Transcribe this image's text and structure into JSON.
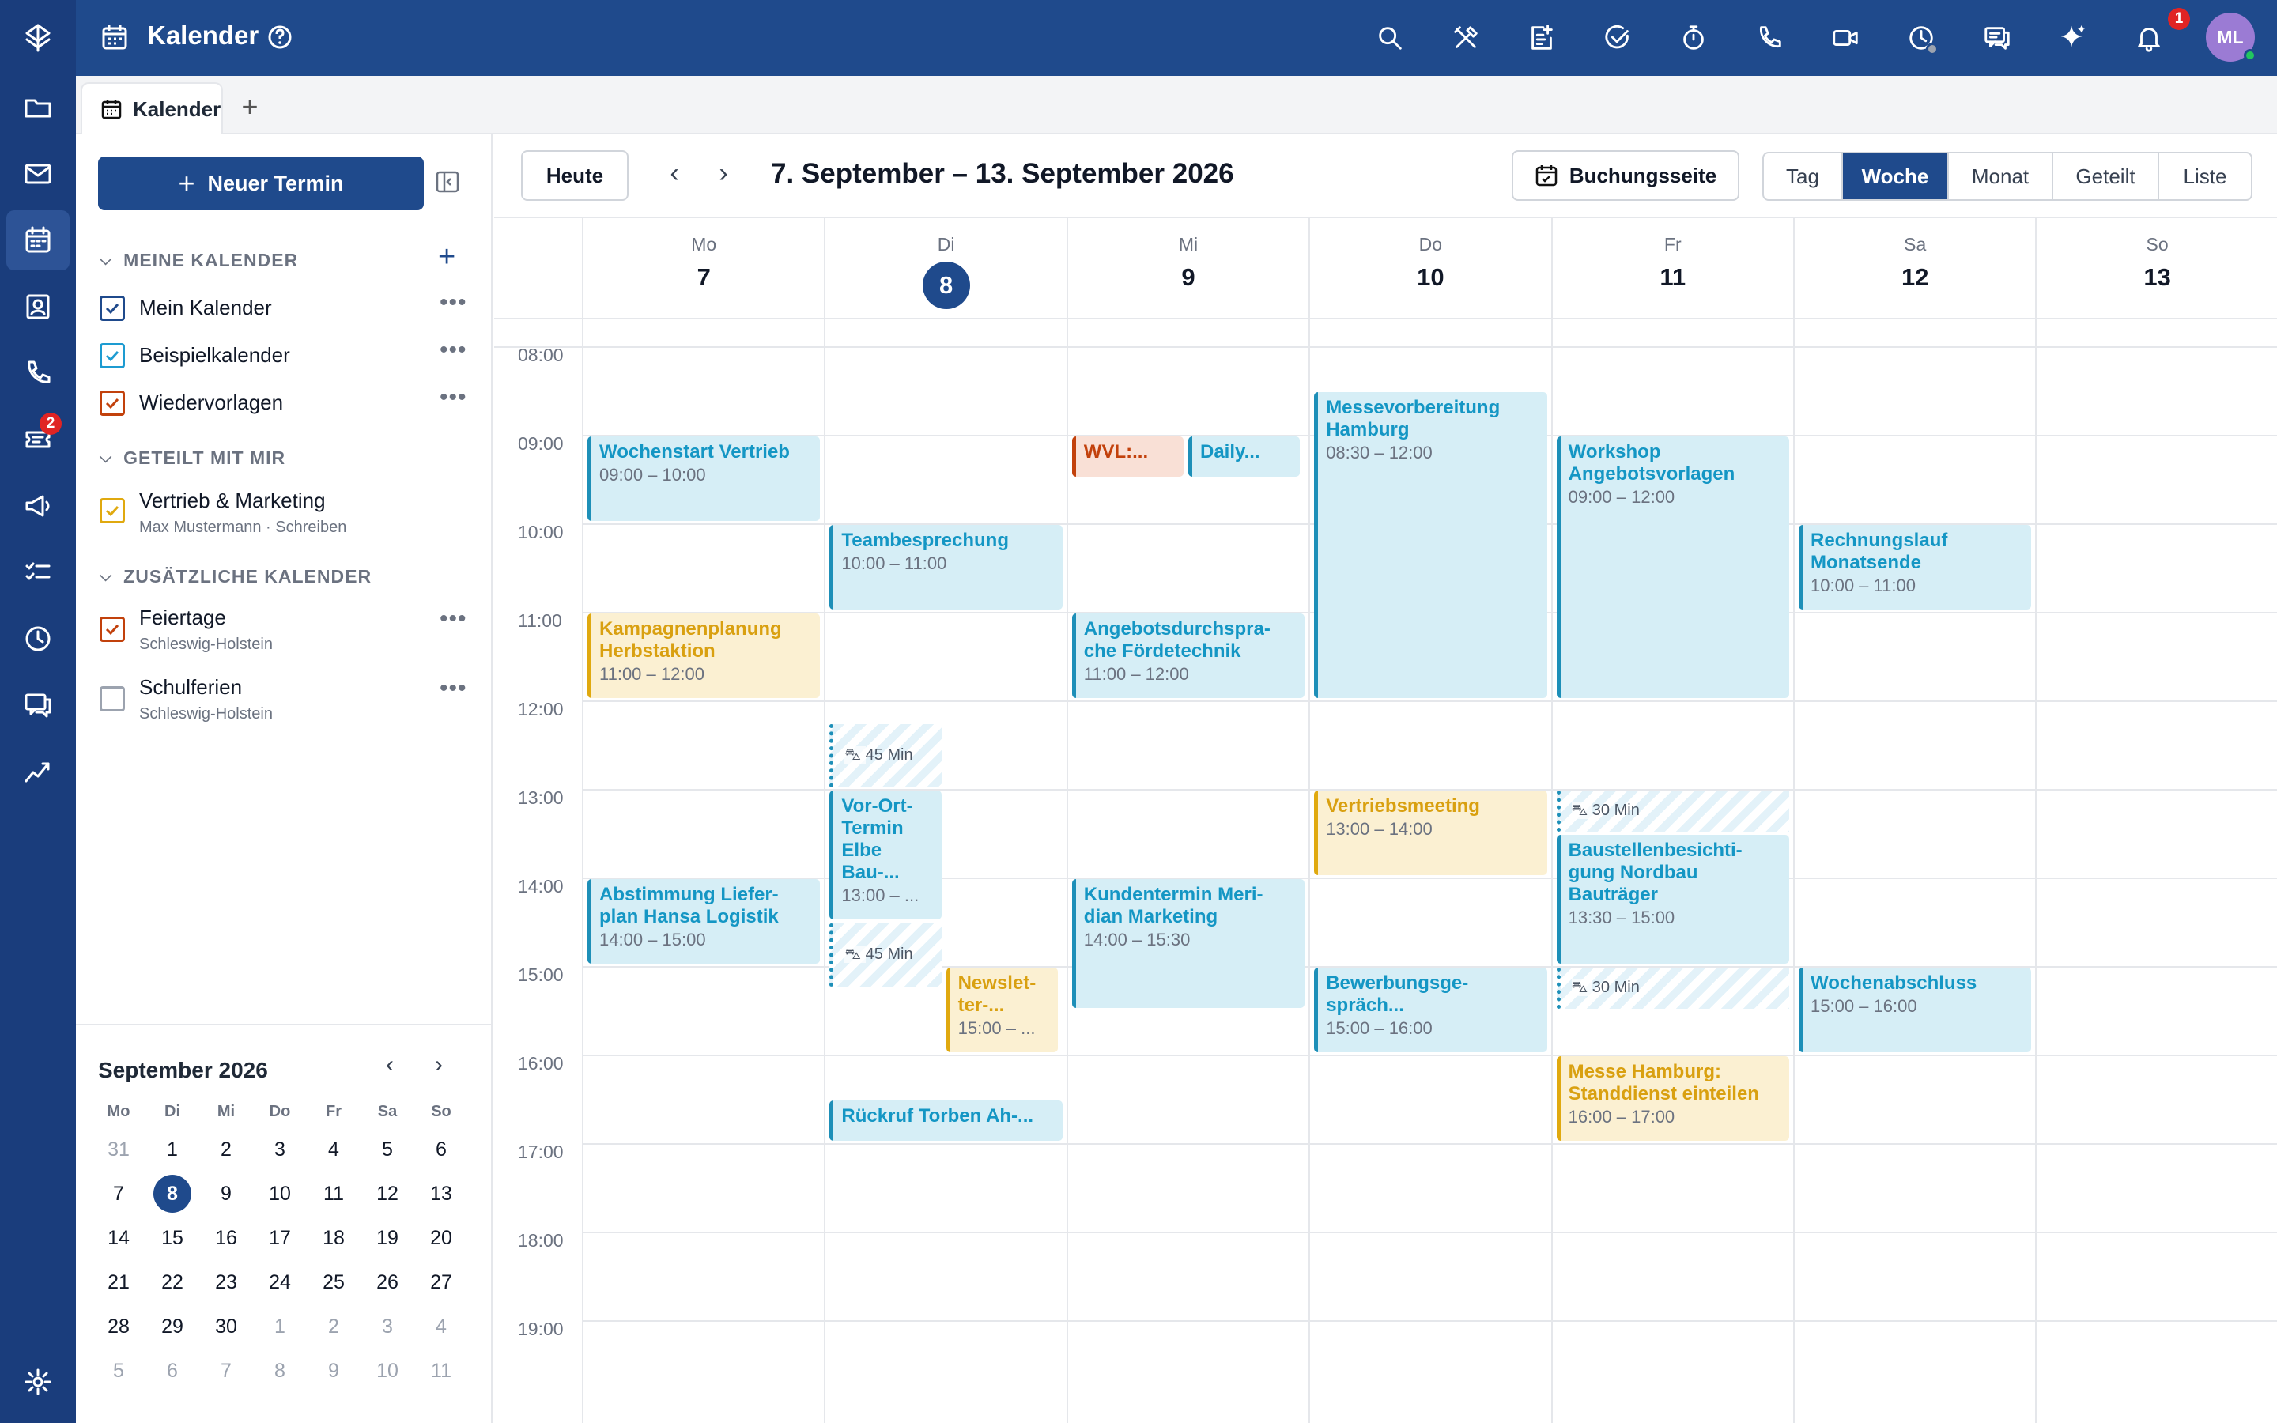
{
  "header": {
    "title": "Kalender",
    "notification_count": "1",
    "avatar_initials": "ML"
  },
  "rail": {
    "tickets_badge": "2"
  },
  "tabs": [
    {
      "label": "Kalender"
    }
  ],
  "sidebar": {
    "new_button": "Neuer Termin",
    "sections": {
      "mine": "MEINE KALENDER",
      "shared": "GETEILT MIT MIR",
      "extra": "ZUSÄTZLICHE KALENDER"
    },
    "calendars": [
      {
        "name": "Mein Kalender",
        "color": "#1f4a8c",
        "checked": true
      },
      {
        "name": "Beispielkalender",
        "color": "#1d9bd1",
        "checked": true
      },
      {
        "name": "Wiedervorlagen",
        "color": "#c2410c",
        "checked": true
      },
      {
        "name": "Vertrieb & Marketing",
        "sub": "Max Mustermann · Schreiben",
        "color": "#e0a90f",
        "checked": true
      },
      {
        "name": "Feiertage",
        "sub": "Schleswig-Holstein",
        "color": "#c2410c",
        "checked": true
      },
      {
        "name": "Schulferien",
        "sub": "Schleswig-Holstein",
        "color": "#9ca3af",
        "checked": false
      }
    ]
  },
  "mini_calendar": {
    "title": "September 2026",
    "weekdays": [
      "Mo",
      "Di",
      "Mi",
      "Do",
      "Fr",
      "Sa",
      "So"
    ],
    "weeks": [
      [
        "31",
        "1",
        "2",
        "3",
        "4",
        "5",
        "6"
      ],
      [
        "7",
        "8",
        "9",
        "10",
        "11",
        "12",
        "13"
      ],
      [
        "14",
        "15",
        "16",
        "17",
        "18",
        "19",
        "20"
      ],
      [
        "21",
        "22",
        "23",
        "24",
        "25",
        "26",
        "27"
      ],
      [
        "28",
        "29",
        "30",
        "1",
        "2",
        "3",
        "4"
      ],
      [
        "5",
        "6",
        "7",
        "8",
        "9",
        "10",
        "11"
      ]
    ],
    "selected": "8"
  },
  "toolbar": {
    "today": "Heute",
    "range": "7. September – 13. September 2026",
    "booking": "Buchungsseite",
    "views": [
      "Tag",
      "Woche",
      "Monat",
      "Geteilt",
      "Liste"
    ],
    "active_view": "Woche"
  },
  "week": {
    "days": [
      {
        "name": "Mo",
        "date": "7"
      },
      {
        "name": "Di",
        "date": "8",
        "today": true
      },
      {
        "name": "Mi",
        "date": "9"
      },
      {
        "name": "Do",
        "date": "10"
      },
      {
        "name": "Fr",
        "date": "11"
      },
      {
        "name": "Sa",
        "date": "12"
      },
      {
        "name": "So",
        "date": "13"
      }
    ],
    "hours": [
      "08:00",
      "09:00",
      "10:00",
      "11:00",
      "12:00",
      "13:00",
      "14:00",
      "15:00",
      "16:00",
      "17:00",
      "18:00",
      "19:00"
    ],
    "events": [
      {
        "title": "Wochenstart Vertrieb",
        "time": "09:00 – 10:00",
        "color": "blue"
      },
      {
        "title": "Kampagnenplanung Herbstaktion",
        "time": "11:00 – 12:00",
        "color": "yellow"
      },
      {
        "title": "Abstimmung Lieferplan Hansa Logistik",
        "title_display": "Abstimmung Liefer-plan Hansa Logistik",
        "time": "14:00 – 15:00",
        "color": "blue"
      },
      {
        "title": "Teambesprechung",
        "time": "10:00 – 11:00",
        "color": "blue"
      },
      {
        "title": "Vor-Ort-Termin Elbe Bau-...",
        "time": "13:00 – ...",
        "color": "blue"
      },
      {
        "title": "Newslet-ter-...",
        "time": "15:00 – ...",
        "color": "yellow"
      },
      {
        "title": "Rückruf Torben Ah-...",
        "color": "blue"
      },
      {
        "title": "WVL:...",
        "color": "orange"
      },
      {
        "title": "Daily...",
        "color": "blue"
      },
      {
        "title": "Angebotsdurchsprache Fördetechnik",
        "title_display": "Angebotsdurchspra-che Fördetechnik",
        "time": "11:00 – 12:00",
        "color": "blue"
      },
      {
        "title": "Kundentermin Meridian Marketing",
        "title_display": "Kundentermin Meri-dian Marketing",
        "time": "14:00 – 15:30",
        "color": "blue"
      },
      {
        "title": "Messevorbereitung Hamburg",
        "time": "08:30 – 12:00",
        "color": "blue"
      },
      {
        "title": "Vertriebsmeeting",
        "time": "13:00 – 14:00",
        "color": "yellow"
      },
      {
        "title": "Bewerbungsgespräch...",
        "title_display": "Bewerbungsge-spräch...",
        "time": "15:00 – 16:00",
        "color": "blue"
      },
      {
        "title": "Workshop Angebotsvorlagen",
        "time": "09:00 – 12:00",
        "color": "blue"
      },
      {
        "title": "Baustellenbesichtigung Nordbau Bauträger",
        "title_display": "Baustellenbesichti-gung Nordbau Bauträger",
        "time": "13:30 – 15:00",
        "color": "blue"
      },
      {
        "title": "Messe Hamburg: Standdienst einteilen",
        "time": "16:00 – 17:00",
        "color": "yellow"
      },
      {
        "title": "Rechnungslauf Monatsende",
        "time": "10:00 – 11:00",
        "color": "blue"
      },
      {
        "title": "Wochenabschluss",
        "time": "15:00 – 16:00",
        "color": "blue"
      }
    ],
    "travel": [
      "45 Min",
      "45 Min",
      "30 Min",
      "30 Min"
    ]
  }
}
